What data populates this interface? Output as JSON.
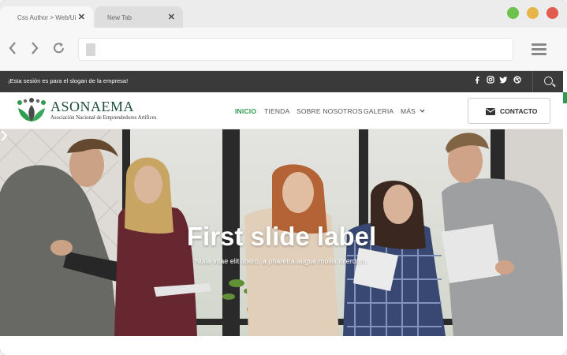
{
  "browser": {
    "tabs": [
      {
        "label": "Css Author > Web/Ui",
        "close": "✕"
      },
      {
        "label": "New Tab",
        "close": "✕"
      }
    ],
    "window_dots": [
      "#6cc24a",
      "#e6b54a",
      "#e25b4f"
    ]
  },
  "topbar": {
    "slogan": "¡Esta sesión es para el slogan de la empresa!",
    "social": [
      "facebook-icon",
      "instagram-icon",
      "twitter-icon",
      "dribbble-icon"
    ]
  },
  "site": {
    "brand": "ASONAEMA",
    "tagline": "Asociación Nacional de Emprendedores Artífices",
    "menu": [
      "INICIO",
      "TIENDA",
      "SOBRE NOSOTROS",
      "GALERIA",
      "MÁS"
    ],
    "contact_label": "CONTACTO",
    "accent": "#2e9c4e"
  },
  "hero": {
    "title": "First slide label",
    "subtitle": "Nulla vitae elit libero, a pharetra augue mollis interdum."
  }
}
